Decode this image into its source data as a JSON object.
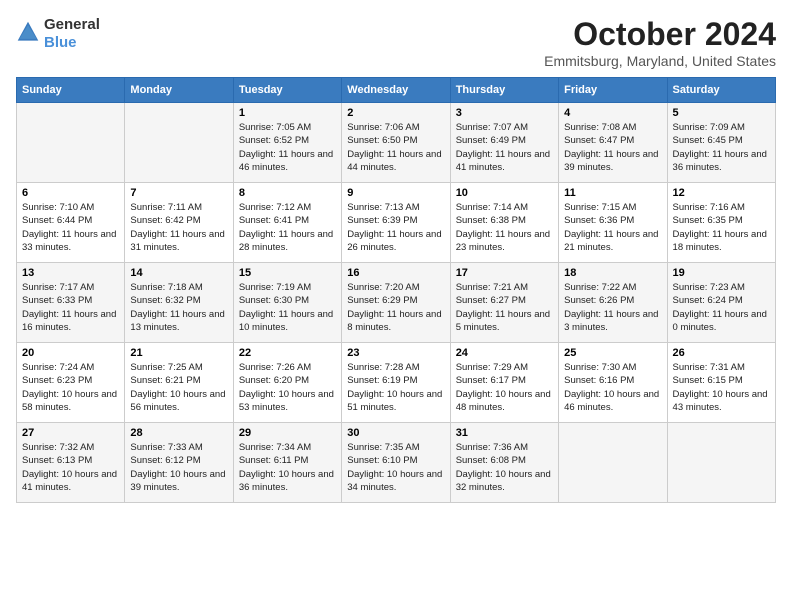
{
  "header": {
    "logo_general": "General",
    "logo_blue": "Blue",
    "month_title": "October 2024",
    "location": "Emmitsburg, Maryland, United States"
  },
  "weekdays": [
    "Sunday",
    "Monday",
    "Tuesday",
    "Wednesday",
    "Thursday",
    "Friday",
    "Saturday"
  ],
  "weeks": [
    [
      {
        "day": "",
        "info": ""
      },
      {
        "day": "",
        "info": ""
      },
      {
        "day": "1",
        "info": "Sunrise: 7:05 AM\nSunset: 6:52 PM\nDaylight: 11 hours and 46 minutes."
      },
      {
        "day": "2",
        "info": "Sunrise: 7:06 AM\nSunset: 6:50 PM\nDaylight: 11 hours and 44 minutes."
      },
      {
        "day": "3",
        "info": "Sunrise: 7:07 AM\nSunset: 6:49 PM\nDaylight: 11 hours and 41 minutes."
      },
      {
        "day": "4",
        "info": "Sunrise: 7:08 AM\nSunset: 6:47 PM\nDaylight: 11 hours and 39 minutes."
      },
      {
        "day": "5",
        "info": "Sunrise: 7:09 AM\nSunset: 6:45 PM\nDaylight: 11 hours and 36 minutes."
      }
    ],
    [
      {
        "day": "6",
        "info": "Sunrise: 7:10 AM\nSunset: 6:44 PM\nDaylight: 11 hours and 33 minutes."
      },
      {
        "day": "7",
        "info": "Sunrise: 7:11 AM\nSunset: 6:42 PM\nDaylight: 11 hours and 31 minutes."
      },
      {
        "day": "8",
        "info": "Sunrise: 7:12 AM\nSunset: 6:41 PM\nDaylight: 11 hours and 28 minutes."
      },
      {
        "day": "9",
        "info": "Sunrise: 7:13 AM\nSunset: 6:39 PM\nDaylight: 11 hours and 26 minutes."
      },
      {
        "day": "10",
        "info": "Sunrise: 7:14 AM\nSunset: 6:38 PM\nDaylight: 11 hours and 23 minutes."
      },
      {
        "day": "11",
        "info": "Sunrise: 7:15 AM\nSunset: 6:36 PM\nDaylight: 11 hours and 21 minutes."
      },
      {
        "day": "12",
        "info": "Sunrise: 7:16 AM\nSunset: 6:35 PM\nDaylight: 11 hours and 18 minutes."
      }
    ],
    [
      {
        "day": "13",
        "info": "Sunrise: 7:17 AM\nSunset: 6:33 PM\nDaylight: 11 hours and 16 minutes."
      },
      {
        "day": "14",
        "info": "Sunrise: 7:18 AM\nSunset: 6:32 PM\nDaylight: 11 hours and 13 minutes."
      },
      {
        "day": "15",
        "info": "Sunrise: 7:19 AM\nSunset: 6:30 PM\nDaylight: 11 hours and 10 minutes."
      },
      {
        "day": "16",
        "info": "Sunrise: 7:20 AM\nSunset: 6:29 PM\nDaylight: 11 hours and 8 minutes."
      },
      {
        "day": "17",
        "info": "Sunrise: 7:21 AM\nSunset: 6:27 PM\nDaylight: 11 hours and 5 minutes."
      },
      {
        "day": "18",
        "info": "Sunrise: 7:22 AM\nSunset: 6:26 PM\nDaylight: 11 hours and 3 minutes."
      },
      {
        "day": "19",
        "info": "Sunrise: 7:23 AM\nSunset: 6:24 PM\nDaylight: 11 hours and 0 minutes."
      }
    ],
    [
      {
        "day": "20",
        "info": "Sunrise: 7:24 AM\nSunset: 6:23 PM\nDaylight: 10 hours and 58 minutes."
      },
      {
        "day": "21",
        "info": "Sunrise: 7:25 AM\nSunset: 6:21 PM\nDaylight: 10 hours and 56 minutes."
      },
      {
        "day": "22",
        "info": "Sunrise: 7:26 AM\nSunset: 6:20 PM\nDaylight: 10 hours and 53 minutes."
      },
      {
        "day": "23",
        "info": "Sunrise: 7:28 AM\nSunset: 6:19 PM\nDaylight: 10 hours and 51 minutes."
      },
      {
        "day": "24",
        "info": "Sunrise: 7:29 AM\nSunset: 6:17 PM\nDaylight: 10 hours and 48 minutes."
      },
      {
        "day": "25",
        "info": "Sunrise: 7:30 AM\nSunset: 6:16 PM\nDaylight: 10 hours and 46 minutes."
      },
      {
        "day": "26",
        "info": "Sunrise: 7:31 AM\nSunset: 6:15 PM\nDaylight: 10 hours and 43 minutes."
      }
    ],
    [
      {
        "day": "27",
        "info": "Sunrise: 7:32 AM\nSunset: 6:13 PM\nDaylight: 10 hours and 41 minutes."
      },
      {
        "day": "28",
        "info": "Sunrise: 7:33 AM\nSunset: 6:12 PM\nDaylight: 10 hours and 39 minutes."
      },
      {
        "day": "29",
        "info": "Sunrise: 7:34 AM\nSunset: 6:11 PM\nDaylight: 10 hours and 36 minutes."
      },
      {
        "day": "30",
        "info": "Sunrise: 7:35 AM\nSunset: 6:10 PM\nDaylight: 10 hours and 34 minutes."
      },
      {
        "day": "31",
        "info": "Sunrise: 7:36 AM\nSunset: 6:08 PM\nDaylight: 10 hours and 32 minutes."
      },
      {
        "day": "",
        "info": ""
      },
      {
        "day": "",
        "info": ""
      }
    ]
  ]
}
